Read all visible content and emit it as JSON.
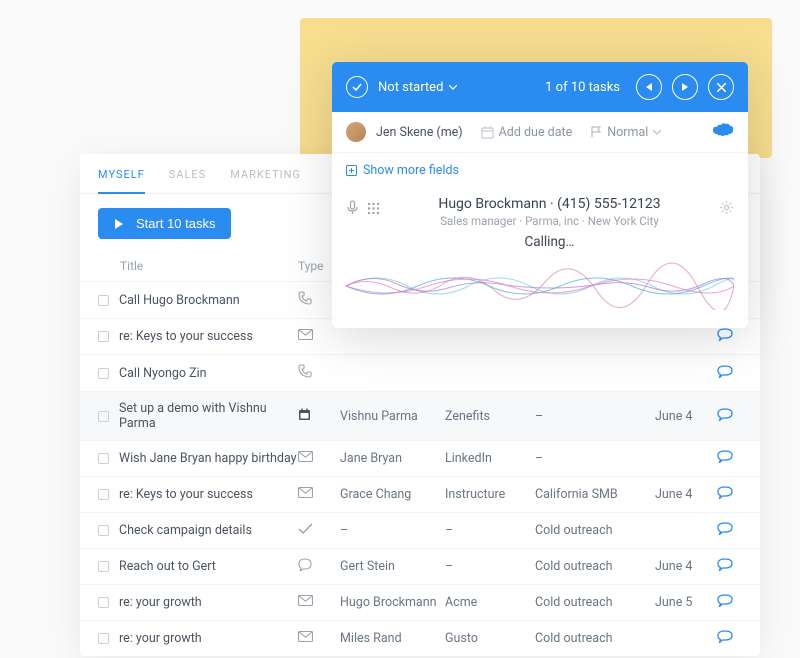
{
  "tabs": {
    "myself": "MYSELF",
    "sales": "SALES",
    "marketing": "MARKETING"
  },
  "start_button": "Start 10 tasks",
  "table": {
    "headers": {
      "title": "Title",
      "type": "Type"
    },
    "rows": [
      {
        "title": "Call Hugo Brockmann",
        "type": "phone",
        "assignee": "",
        "account": "",
        "campaign": "",
        "date": "",
        "highlighted": false
      },
      {
        "title": "re: Keys to your success",
        "type": "mail",
        "assignee": "",
        "account": "",
        "campaign": "",
        "date": "",
        "highlighted": false
      },
      {
        "title": "Call Nyongo Zin",
        "type": "phone",
        "assignee": "",
        "account": "",
        "campaign": "",
        "date": "",
        "highlighted": false
      },
      {
        "title": "Set up a demo with Vishnu Parma",
        "type": "calendar",
        "assignee": "Vishnu Parma",
        "account": "Zenefits",
        "campaign": "–",
        "date": "June 4",
        "highlighted": true
      },
      {
        "title": "Wish Jane Bryan happy birthday",
        "type": "mail",
        "assignee": "Jane Bryan",
        "account": "LinkedIn",
        "campaign": "–",
        "date": "",
        "highlighted": false
      },
      {
        "title": "re: Keys to your success",
        "type": "mail",
        "assignee": "Grace Chang",
        "account": "Instructure",
        "campaign": "California SMB",
        "date": "June 4",
        "highlighted": false
      },
      {
        "title": "Check campaign details",
        "type": "check",
        "assignee": "–",
        "account": "–",
        "campaign": "Cold outreach",
        "date": "",
        "highlighted": false
      },
      {
        "title": "Reach out to Gert",
        "type": "chat",
        "assignee": "Gert Stein",
        "account": "–",
        "campaign": "Cold outreach",
        "date": "June 4",
        "highlighted": false
      },
      {
        "title": "re: your growth",
        "type": "mail",
        "assignee": "Hugo Brockmann",
        "account": "Acme",
        "campaign": "Cold outreach",
        "date": "June 5",
        "highlighted": false
      },
      {
        "title": "re: your growth",
        "type": "mail",
        "assignee": "Miles Rand",
        "account": "Gusto",
        "campaign": "Cold outreach",
        "date": "",
        "highlighted": false
      }
    ]
  },
  "panel": {
    "status": "Not started",
    "counter": "1 of 10 tasks",
    "assignee": "Jen Skene (me)",
    "due_label": "Add due date",
    "priority": "Normal",
    "show_more": "Show more fields",
    "call": {
      "name": "Hugo Brockmann",
      "phone": "(415) 555-12123",
      "dot": " · ",
      "role": "Sales manager",
      "company": "Parma, inc",
      "location": "New York City",
      "sep": " · ",
      "status": "Calling…"
    }
  }
}
